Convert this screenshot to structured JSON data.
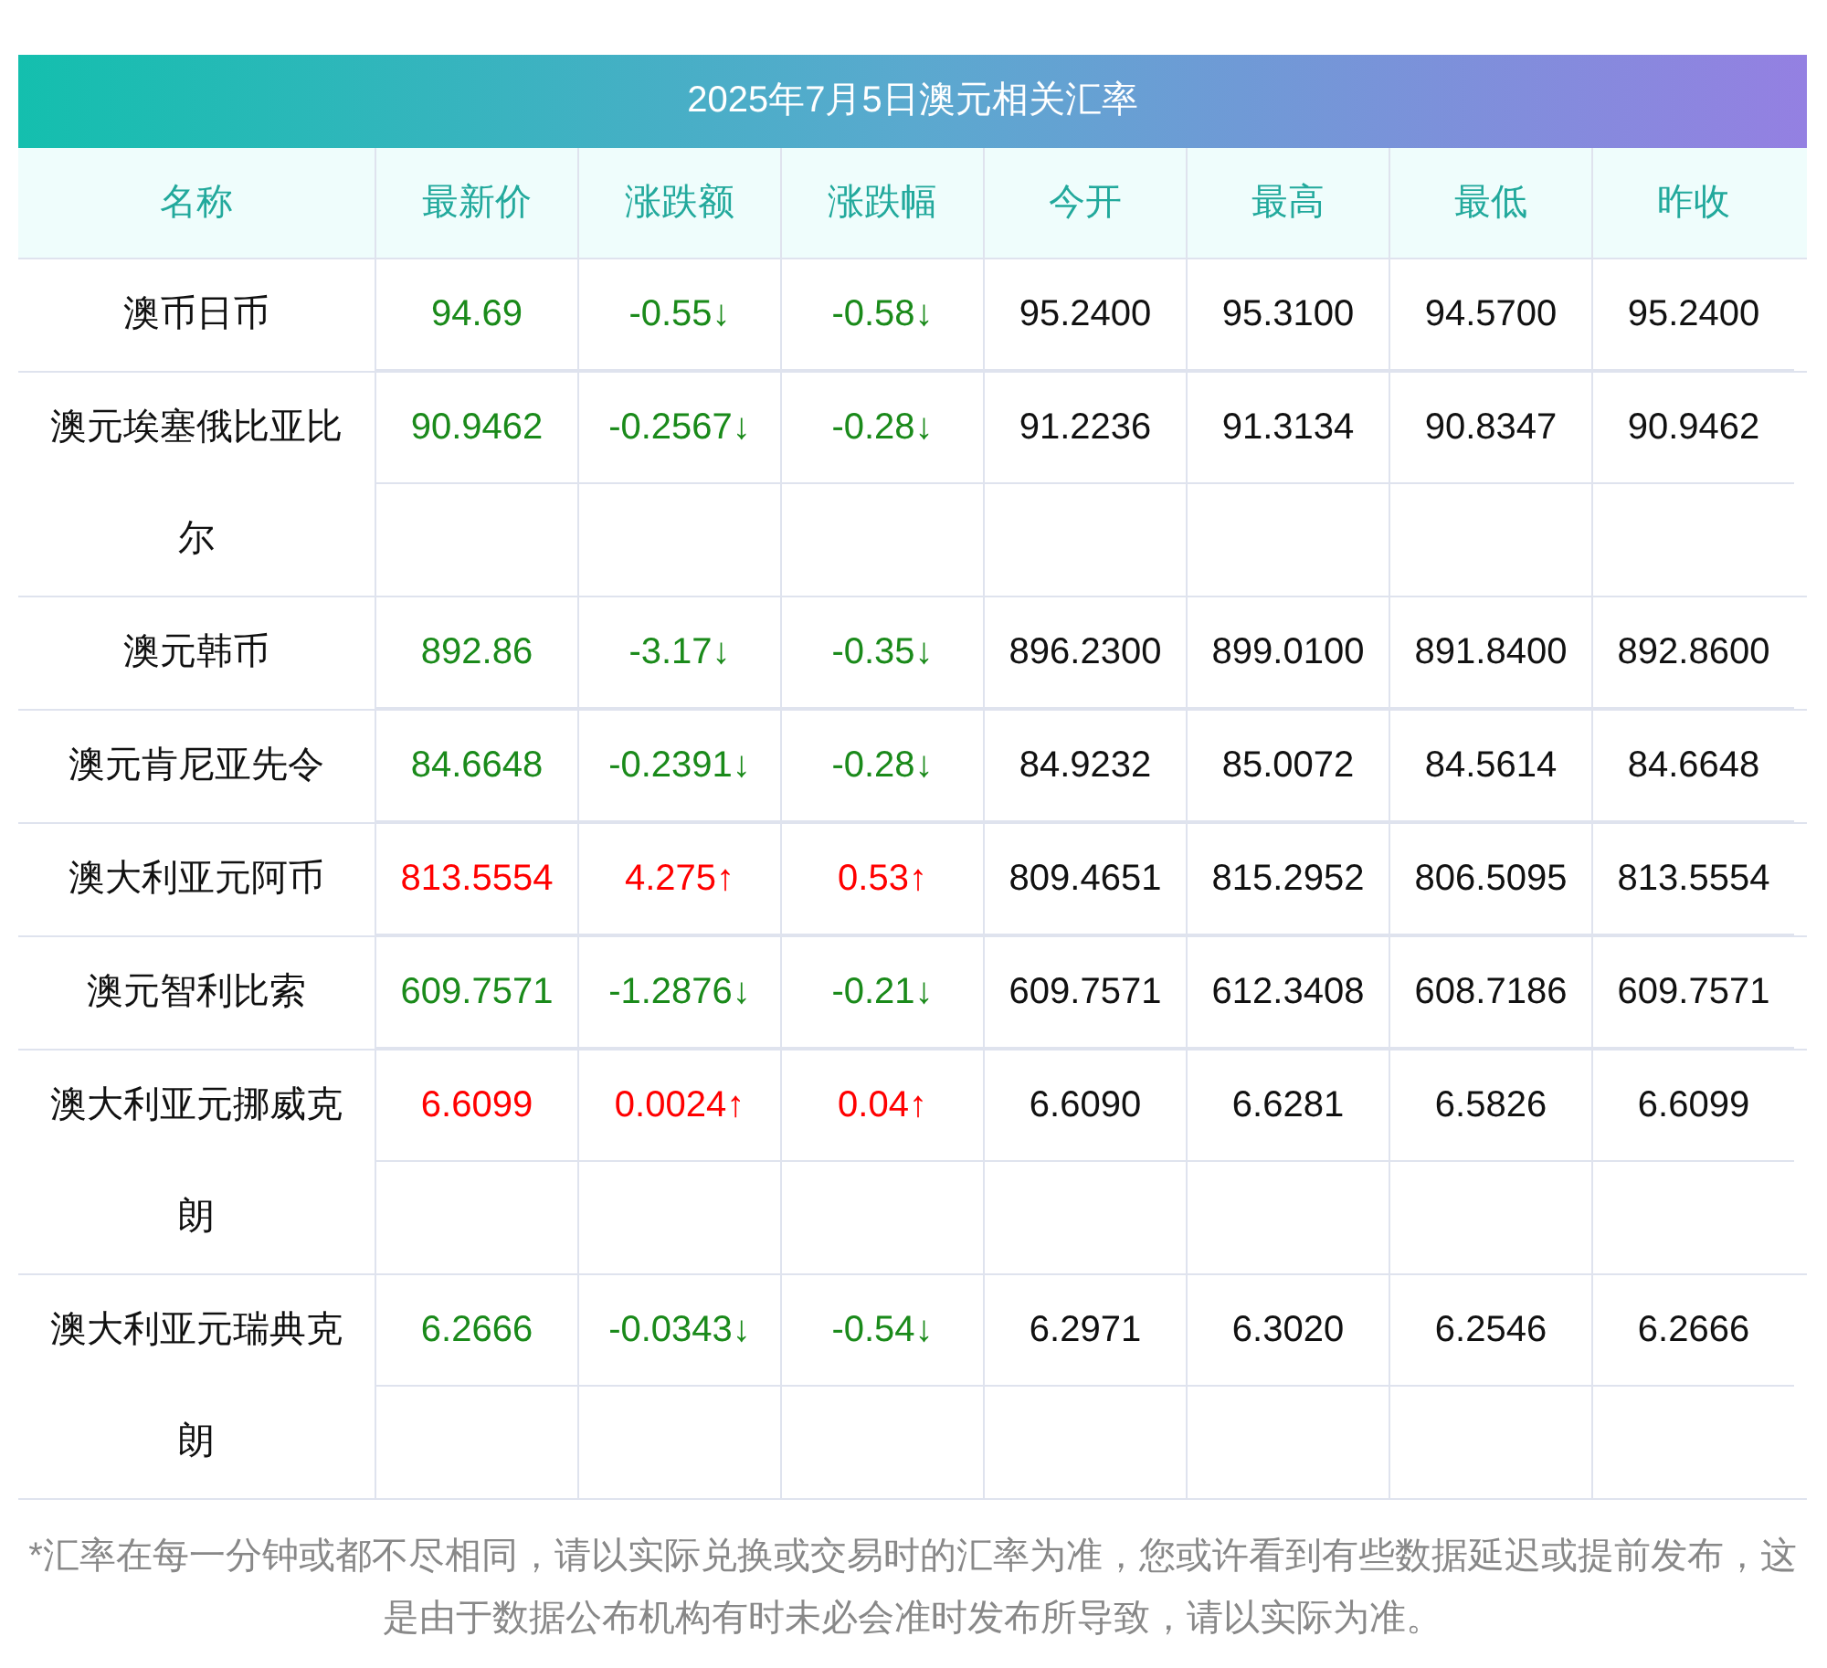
{
  "table": {
    "title": "2025年7月5日澳元相关汇率",
    "columns": [
      "名称",
      "最新价",
      "涨跌额",
      "涨跌幅",
      "今开",
      "最高",
      "最低",
      "昨收"
    ],
    "rows": [
      {
        "name": "澳币日币",
        "color": "#1a8a1a",
        "latest": "94.69",
        "change": "-0.55↓",
        "change_pct": "-0.58↓",
        "open": "95.2400",
        "high": "95.3100",
        "low": "94.5700",
        "prev_close": "95.2400"
      },
      {
        "name": "澳元埃塞俄比亚比尔",
        "color": "#1a8a1a",
        "latest": "90.9462",
        "change": "-0.2567↓",
        "change_pct": "-0.28↓",
        "open": "91.2236",
        "high": "91.3134",
        "low": "90.8347",
        "prev_close": "90.9462"
      },
      {
        "name": "澳元韩币",
        "color": "#1a8a1a",
        "latest": "892.86",
        "change": "-3.17↓",
        "change_pct": "-0.35↓",
        "open": "896.2300",
        "high": "899.0100",
        "low": "891.8400",
        "prev_close": "892.8600"
      },
      {
        "name": "澳元肯尼亚先令",
        "color": "#1a8a1a",
        "latest": "84.6648",
        "change": "-0.2391↓",
        "change_pct": "-0.28↓",
        "open": "84.9232",
        "high": "85.0072",
        "low": "84.5614",
        "prev_close": "84.6648"
      },
      {
        "name": "澳大利亚元阿币",
        "color": "#ff0000",
        "latest": "813.5554",
        "change": "4.275↑",
        "change_pct": "0.53↑",
        "open": "809.4651",
        "high": "815.2952",
        "low": "806.5095",
        "prev_close": "813.5554"
      },
      {
        "name": "澳元智利比索",
        "color": "#1a8a1a",
        "latest": "609.7571",
        "change": "-1.2876↓",
        "change_pct": "-0.21↓",
        "open": "609.7571",
        "high": "612.3408",
        "low": "608.7186",
        "prev_close": "609.7571"
      },
      {
        "name": "澳大利亚元挪威克朗",
        "color": "#ff0000",
        "latest": "6.6099",
        "change": "0.0024↑",
        "change_pct": "0.04↑",
        "open": "6.6090",
        "high": "6.6281",
        "low": "6.5826",
        "prev_close": "6.6099"
      },
      {
        "name": "澳大利亚元瑞典克朗",
        "color": "#1a8a1a",
        "latest": "6.2666",
        "change": "-0.0343↓",
        "change_pct": "-0.54↓",
        "open": "6.2971",
        "high": "6.3020",
        "low": "6.2546",
        "prev_close": "6.2666"
      }
    ]
  },
  "footnote": "*汇率在每一分钟或都不尽相同，请以实际兑换或交易时的汇率为准，您或许看到有些数据延迟或提前发布，这是由于数据公布机构有时未必会准时发布所导致，请以实际为准。"
}
